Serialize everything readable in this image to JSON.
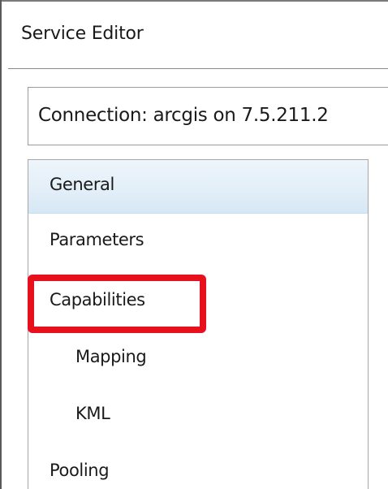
{
  "window": {
    "title": "Service Editor"
  },
  "connection": {
    "label": "Connection: arcgis on 7.5.211.2"
  },
  "nav": {
    "items": [
      {
        "label": "General"
      },
      {
        "label": "Parameters"
      },
      {
        "label": "Capabilities"
      },
      {
        "label": "Mapping"
      },
      {
        "label": "KML"
      },
      {
        "label": "Pooling"
      }
    ],
    "selected": "General",
    "annotated": "Capabilities"
  },
  "colors": {
    "selection_bg": "#e2eef8",
    "annotation_red": "#e8101c",
    "text": "#1a1a1a"
  }
}
